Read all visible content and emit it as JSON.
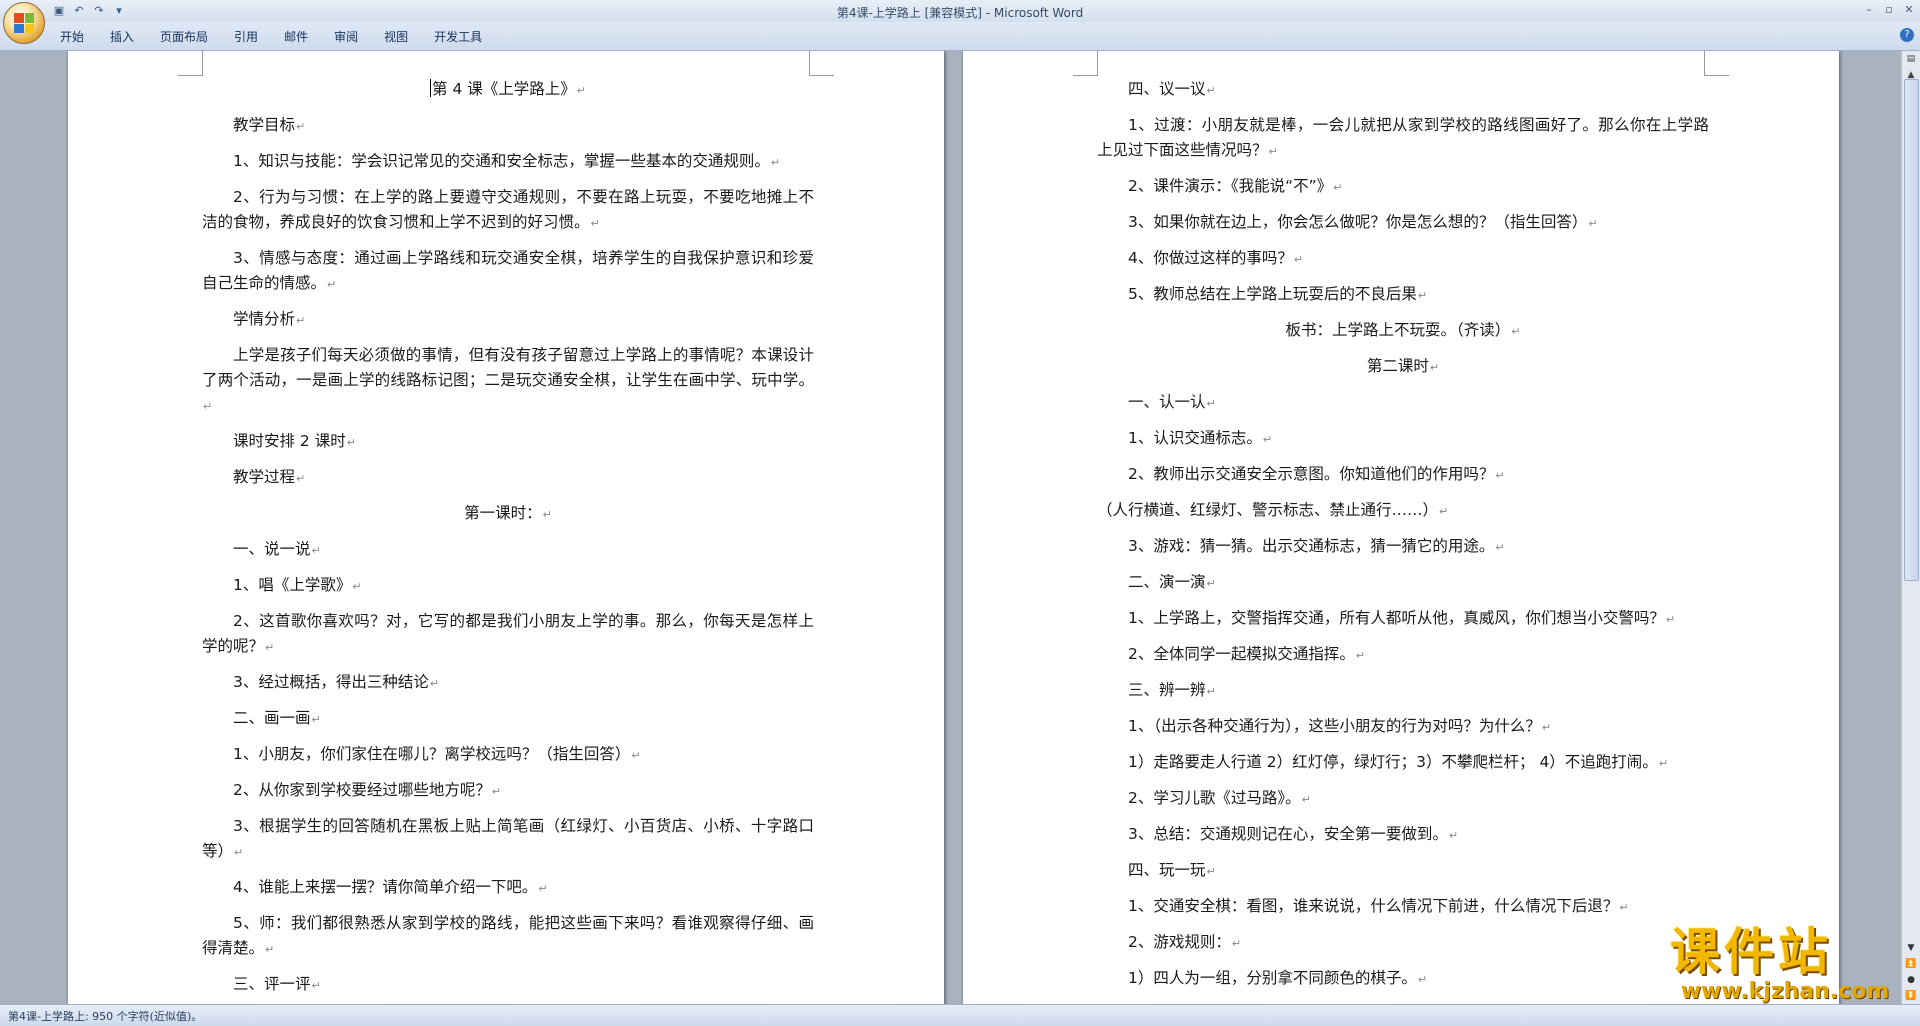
{
  "window": {
    "title": "第4课-上学路上 [兼容模式] - Microsoft Word"
  },
  "ribbon": {
    "tabs": [
      "开始",
      "插入",
      "页面布局",
      "引用",
      "邮件",
      "审阅",
      "视图",
      "开发工具"
    ]
  },
  "quick_access_icons": [
    "save-icon",
    "undo-icon",
    "redo-icon",
    "customize-icon"
  ],
  "left_page": {
    "paragraphs": [
      {
        "text": "第 4 课《上学路上》",
        "align": "center"
      },
      {
        "text": "教学目标",
        "align": "indent"
      },
      {
        "text": "1、知识与技能：学会识记常见的交通和安全标志，掌握一些基本的交通规则。",
        "align": "indent"
      },
      {
        "text": "2、行为与习惯：在上学的路上要遵守交通规则，不要在路上玩耍，不要吃地摊上不洁的食物，养成良好的饮食习惯和上学不迟到的好习惯。",
        "align": "indent"
      },
      {
        "text": "3、情感与态度：通过画上学路线和玩交通安全棋，培养学生的自我保护意识和珍爱自己生命的情感。",
        "align": "indent"
      },
      {
        "text": "学情分析",
        "align": "indent"
      },
      {
        "text": "上学是孩子们每天必须做的事情，但有没有孩子留意过上学路上的事情呢？本课设计了两个活动，一是画上学的线路标记图；二是玩交通安全棋，让学生在画中学、玩中学。",
        "align": "indent"
      },
      {
        "text": "课时安排      2 课时",
        "align": "indent"
      },
      {
        "text": "教学过程",
        "align": "indent"
      },
      {
        "text": "第一课时：",
        "align": "center"
      },
      {
        "text": "一、说一说",
        "align": "indent"
      },
      {
        "text": "1、唱《上学歌》",
        "align": "indent"
      },
      {
        "text": "2、这首歌你喜欢吗？对，它写的都是我们小朋友上学的事。那么，你每天是怎样上学的呢？",
        "align": "indent"
      },
      {
        "text": "3、经过概括，得出三种结论",
        "align": "indent"
      },
      {
        "text": "二、画一画",
        "align": "indent"
      },
      {
        "text": "1、小朋友，你们家住在哪儿？离学校远吗？（指生回答）",
        "align": "indent"
      },
      {
        "text": "2、从你家到学校要经过哪些地方呢？",
        "align": "indent"
      },
      {
        "text": "3、根据学生的回答随机在黑板上贴上简笔画（红绿灯、小百货店、小桥、十字路口等）",
        "align": "indent"
      },
      {
        "text": "4、谁能上来摆一摆？请你简单介绍一下吧。",
        "align": "indent"
      },
      {
        "text": "5、师：我们都很熟悉从家到学校的路线，能把这些画下来吗？看谁观察得仔细、画得清楚。",
        "align": "indent"
      },
      {
        "text": "三、评一评",
        "align": "indent"
      }
    ]
  },
  "right_page": {
    "paragraphs": [
      {
        "text": "四、议一议",
        "align": "indent"
      },
      {
        "text": "1、过渡：小朋友就是棒，一会儿就把从家到学校的路线图画好了。那么你在上学路上见过下面这些情况吗？",
        "align": "indent"
      },
      {
        "text": "2、课件演示：《我能说“不”》",
        "align": "indent"
      },
      {
        "text": "3、如果你就在边上，你会怎么做呢？你是怎么想的？（指生回答）",
        "align": "indent"
      },
      {
        "text": "4、你做过这样的事吗？",
        "align": "indent"
      },
      {
        "text": "5、教师总结在上学路上玩耍后的不良后果",
        "align": "indent"
      },
      {
        "text": "板书：上学路上不玩耍。（齐读）",
        "align": "center"
      },
      {
        "text": "第二课时",
        "align": "center"
      },
      {
        "text": "一、认一认",
        "align": "indent"
      },
      {
        "text": "1、认识交通标志。",
        "align": "indent"
      },
      {
        "text": "2、教师出示交通安全示意图。你知道他们的作用吗？",
        "align": "indent"
      },
      {
        "text": "（人行横道、红绿灯、警示标志、禁止通行……）",
        "align": "noindent"
      },
      {
        "text": "3、游戏：猜一猜。出示交通标志，猜一猜它的用途。",
        "align": "indent"
      },
      {
        "text": "二、演一演",
        "align": "indent"
      },
      {
        "text": "1、上学路上，交警指挥交通，所有人都听从他，真威风，你们想当小交警吗？",
        "align": "indent"
      },
      {
        "text": "2、全体同学一起模拟交通指挥。",
        "align": "indent"
      },
      {
        "text": "三、辨一辨",
        "align": "indent"
      },
      {
        "text": "1、（出示各种交通行为），这些小朋友的行为对吗？为什么？",
        "align": "indent"
      },
      {
        "text": "1）走路要走人行道 2）红灯停，绿灯行；3）不攀爬栏杆；  4）不追跑打闹。",
        "align": "indent"
      },
      {
        "text": "2、学习儿歌《过马路》。",
        "align": "indent"
      },
      {
        "text": "3、总结：交通规则记在心，安全第一要做到。",
        "align": "indent"
      },
      {
        "text": "四、玩一玩",
        "align": "indent"
      },
      {
        "text": "1、交通安全棋：看图，谁来说说，什么情况下前进，什么情况下后退？",
        "align": "indent"
      },
      {
        "text": "2、游戏规则：",
        "align": "indent"
      },
      {
        "text": "1）四人为一组，分别拿不同颜色的棋子。",
        "align": "indent"
      }
    ]
  },
  "statusbar": {
    "text": "第4课-上学路上: 950 个字符(近似值)。"
  },
  "watermark": {
    "title": "课件站",
    "url": "www.kjzhan.com"
  },
  "colors": {
    "ribbon_bg": "#dfe8f5",
    "workspace_bg": "#a9b3c0",
    "watermark_gold": "#f2b800"
  }
}
